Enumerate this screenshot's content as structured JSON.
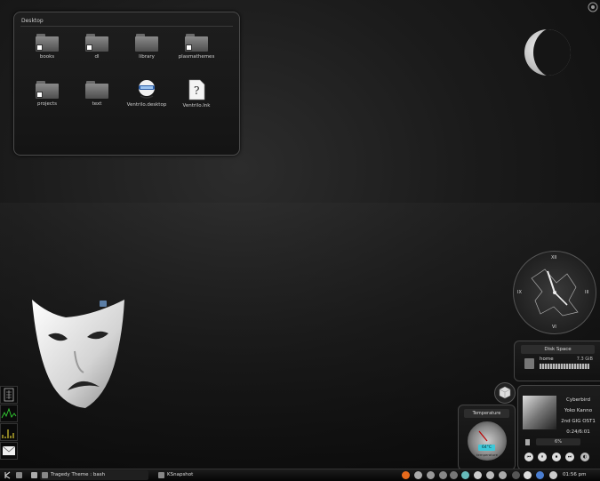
{
  "folderview": {
    "title": "Desktop",
    "items": [
      {
        "label": "books",
        "icon": "folder-icon"
      },
      {
        "label": "dl",
        "icon": "folder-icon"
      },
      {
        "label": "library",
        "icon": "folder-icon"
      },
      {
        "label": "plasmathemes",
        "icon": "folder-icon"
      },
      {
        "label": "projects",
        "icon": "folder-icon"
      },
      {
        "label": "text",
        "icon": "folder-icon"
      },
      {
        "label": "Ventrilo.desktop",
        "icon": "ventrilo-icon"
      },
      {
        "label": "Ventrilo.lnk",
        "icon": "unknown-file-icon"
      }
    ]
  },
  "clock": {
    "numerals": {
      "top": "XII",
      "left": "IX",
      "right": "III",
      "bottom": "VI"
    }
  },
  "disk": {
    "title": "Disk Space",
    "name": "home",
    "size": "7.3 GiB"
  },
  "temperature": {
    "title": "Temperature",
    "reading": "64°C",
    "caption": "temperature"
  },
  "player": {
    "title": "Cyberbird",
    "artist": "Yoko Kanno",
    "album": "2nd GIG OST1",
    "time": "0:24/6:01",
    "volume": "6%"
  },
  "taskbar": {
    "tasks": [
      "Tragedy Theme : bash",
      "KSnapshot"
    ],
    "clock": "01:56 pm"
  },
  "colors": {
    "accent": "#3ec7d8",
    "background": "#161616"
  }
}
